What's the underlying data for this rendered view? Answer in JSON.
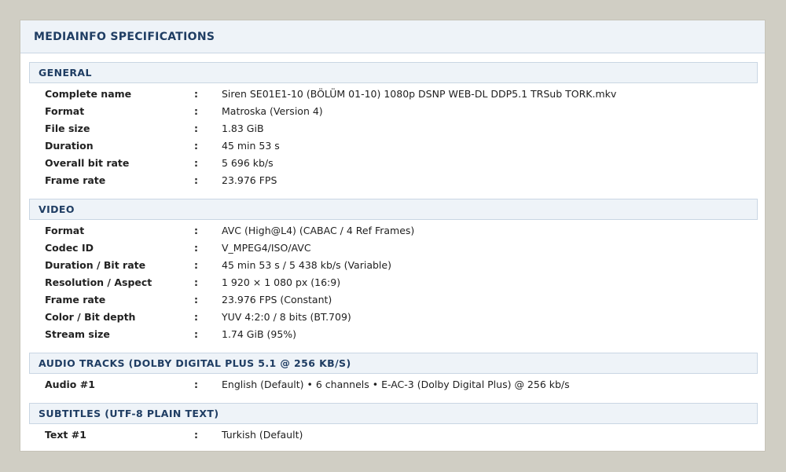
{
  "panel": {
    "title": "MEDIAINFO SPECIFICATIONS"
  },
  "separator": ":",
  "sections": [
    {
      "title": "GENERAL",
      "rows": [
        {
          "label": "Complete name",
          "value": "Siren SE01E1-10 (BÖLÜM 01-10) 1080p DSNP WEB-DL DDP5.1 TRSub TORK.mkv"
        },
        {
          "label": "Format",
          "value": "Matroska (Version 4)"
        },
        {
          "label": "File size",
          "value": "1.83 GiB"
        },
        {
          "label": "Duration",
          "value": "45 min 53 s"
        },
        {
          "label": "Overall bit rate",
          "value": "5 696 kb/s"
        },
        {
          "label": "Frame rate",
          "value": "23.976 FPS"
        }
      ]
    },
    {
      "title": "VIDEO",
      "rows": [
        {
          "label": "Format",
          "value": "AVC (High@L4) (CABAC / 4 Ref Frames)"
        },
        {
          "label": "Codec ID",
          "value": "V_MPEG4/ISO/AVC"
        },
        {
          "label": "Duration / Bit rate",
          "value": "45 min 53 s / 5 438 kb/s (Variable)"
        },
        {
          "label": "Resolution / Aspect",
          "value": "1 920 × 1 080 px (16:9)"
        },
        {
          "label": "Frame rate",
          "value": "23.976 FPS (Constant)"
        },
        {
          "label": "Color / Bit depth",
          "value": "YUV 4:2:0 / 8 bits (BT.709)"
        },
        {
          "label": "Stream size",
          "value": "1.74 GiB (95%)"
        }
      ]
    },
    {
      "title": "AUDIO TRACKS (DOLBY DIGITAL PLUS 5.1 @ 256 KB/S)",
      "rows": [
        {
          "label": "Audio #1",
          "value": "English (Default) • 6 channels • E-AC-3 (Dolby Digital Plus) @ 256 kb/s"
        }
      ]
    },
    {
      "title": "SUBTITLES (UTF-8 PLAIN TEXT)",
      "rows": [
        {
          "label": "Text #1",
          "value": "Turkish (Default)"
        }
      ]
    }
  ]
}
